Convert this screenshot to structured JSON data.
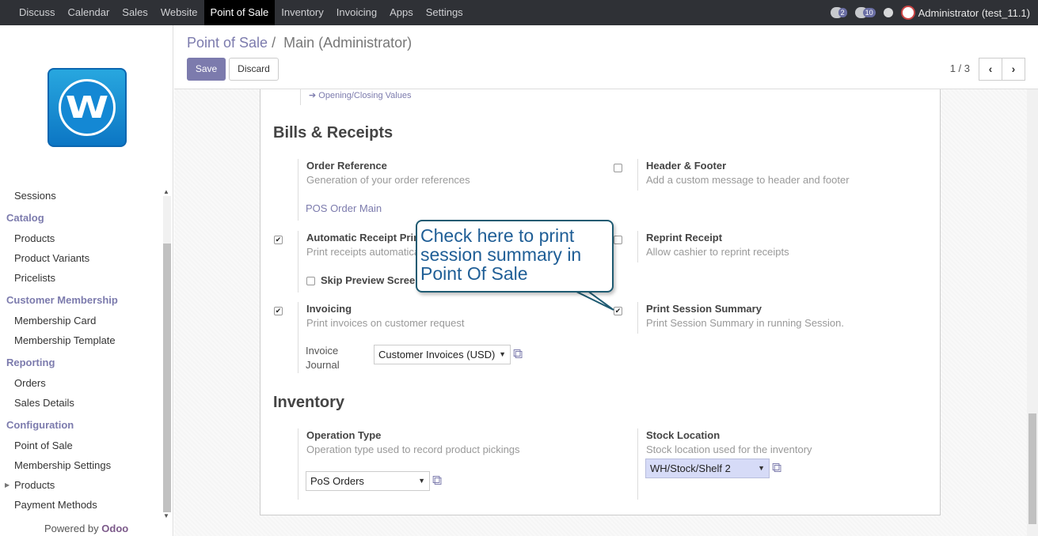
{
  "topbar": {
    "menu": [
      "Discuss",
      "Calendar",
      "Sales",
      "Website",
      "Point of Sale",
      "Inventory",
      "Invoicing",
      "Apps",
      "Settings"
    ],
    "active_index": 4,
    "chat_count": "2",
    "message_count": "10",
    "user": "Administrator (test_11.1)"
  },
  "sidebar": {
    "items": [
      {
        "type": "item",
        "label": "Sessions"
      },
      {
        "type": "section",
        "label": "Catalog"
      },
      {
        "type": "item",
        "label": "Products"
      },
      {
        "type": "item",
        "label": "Product Variants"
      },
      {
        "type": "item",
        "label": "Pricelists"
      },
      {
        "type": "section",
        "label": "Customer Membership"
      },
      {
        "type": "item",
        "label": "Membership Card"
      },
      {
        "type": "item",
        "label": "Membership Template"
      },
      {
        "type": "section",
        "label": "Reporting"
      },
      {
        "type": "item",
        "label": "Orders"
      },
      {
        "type": "item",
        "label": "Sales Details"
      },
      {
        "type": "section",
        "label": "Configuration"
      },
      {
        "type": "item",
        "label": "Point of Sale"
      },
      {
        "type": "item",
        "label": "Membership Settings"
      },
      {
        "type": "item",
        "label": "Products",
        "caret": true
      },
      {
        "type": "item",
        "label": "Payment Methods"
      }
    ],
    "powered_prefix": "Powered by",
    "powered_brand": "Odoo",
    "logo_letter": "W"
  },
  "control_panel": {
    "breadcrumb_parent": "Point of Sale",
    "breadcrumb_sep": "/",
    "breadcrumb_current": "Main (Administrator)",
    "save_label": "Save",
    "discard_label": "Discard",
    "pager": "1 / 3",
    "prev_icon": "chevron-left-icon",
    "next_icon": "chevron-right-icon"
  },
  "form": {
    "opening_link": "Opening/Closing Values",
    "bills_title": "Bills & Receipts",
    "order_ref": {
      "title": "Order Reference",
      "desc": "Generation of your order references",
      "link": "POS Order Main"
    },
    "header_footer": {
      "title": "Header & Footer",
      "desc": "Add a custom message to header and footer",
      "checked": false
    },
    "auto_receipt": {
      "title": "Automatic Receipt Prin",
      "desc": "Print receipts automatica",
      "checked": true
    },
    "skip_preview": {
      "label": "Skip Preview Scree",
      "checked": false
    },
    "reprint": {
      "title": "Reprint Receipt",
      "desc": "Allow cashier to reprint receipts",
      "checked": false
    },
    "invoicing": {
      "title": "Invoicing",
      "desc": "Print invoices on customer request",
      "checked": true
    },
    "session_summary": {
      "title": "Print Session Summary",
      "desc": "Print Session Summary in running Session.",
      "checked": true
    },
    "invoice_journal_label_1": "Invoice",
    "invoice_journal_label_2": "Journal",
    "invoice_journal_value": "Customer Invoices (USD)",
    "inventory_title": "Inventory",
    "operation_type": {
      "title": "Operation Type",
      "desc": "Operation type used to record product pickings",
      "value": "PoS Orders"
    },
    "stock_location": {
      "title": "Stock Location",
      "desc": "Stock location used for the inventory",
      "value": "WH/Stock/Shelf 2"
    }
  },
  "callout": {
    "line1": "Check here to print",
    "line2": "session summary in",
    "line3": "Point Of Sale"
  }
}
